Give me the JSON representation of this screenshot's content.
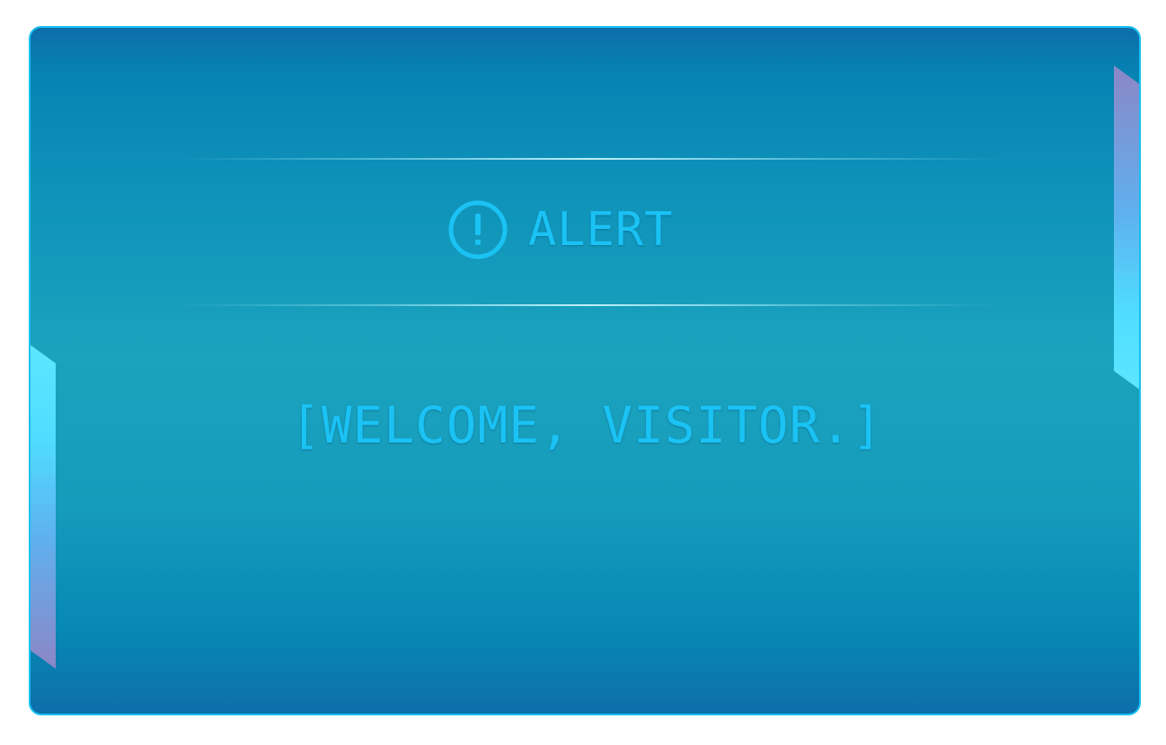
{
  "alert": {
    "icon": "exclamation-circle-icon",
    "label": "ALERT"
  },
  "message": "[WELCOME, VISITOR.]",
  "colors": {
    "text": "#1bc2f4",
    "border": "#16c0f0",
    "panel": "#1aa3bd"
  }
}
